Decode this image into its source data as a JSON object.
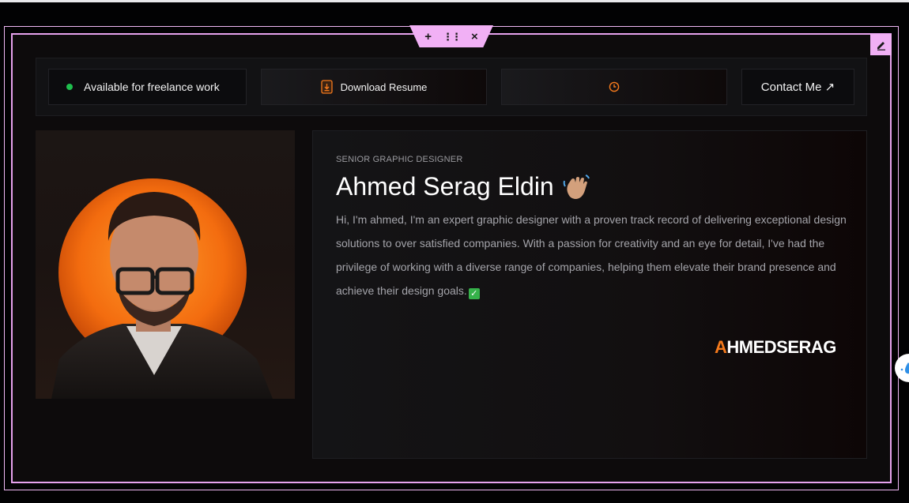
{
  "toolbar": {
    "add_glyph": "+",
    "drag_glyph": "⋮⋮",
    "close_glyph": "×"
  },
  "topbar": {
    "availability_label": "Available for freelance work",
    "resume_label": "Download Resume",
    "contact_label": "Contact Me ↗"
  },
  "profile": {
    "role": "SENIOR GRAPHIC DESIGNER",
    "name": "Ahmed Serag Eldin",
    "bio": "Hi, I'm ahmed, I'm an expert graphic designer with a proven track record of delivering exceptional design solutions to over satisfied companies. With a passion for creativity and an eye for detail, I've had the privilege of working with a diverse range of companies, helping them elevate their brand presence and achieve their design goals.",
    "signature_logo_text": "AHMEDSERAG"
  },
  "icons": {
    "resume": "file-download-icon",
    "clock": "clock-icon",
    "wave": "waving-hand-icon",
    "check": "check-mark-icon",
    "edit": "pencil-icon"
  },
  "colors": {
    "selection_accent": "#f1b0f5",
    "status_green": "#1fbf4d",
    "brand_orange": "#f57a1c",
    "background": "#0d0b0c"
  }
}
